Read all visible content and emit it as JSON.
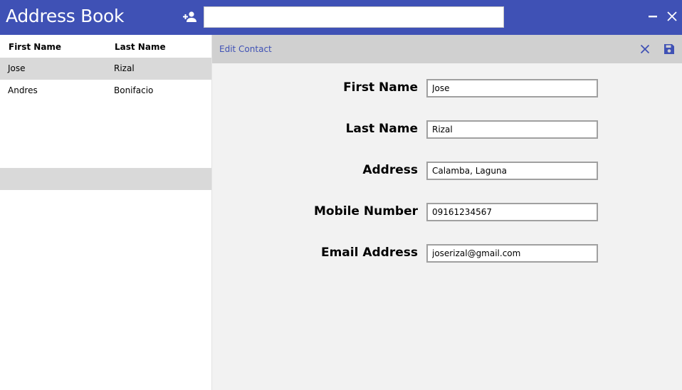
{
  "app": {
    "title": "Address Book"
  },
  "search": {
    "value": "",
    "placeholder": ""
  },
  "list": {
    "columns": [
      "First Name",
      "Last Name"
    ],
    "rows": [
      {
        "first": "Jose",
        "last": "Rizal",
        "selected": true
      },
      {
        "first": "Andres",
        "last": "Bonifacio",
        "selected": false
      }
    ]
  },
  "editor": {
    "title": "Edit Contact",
    "fields": [
      {
        "label": "First Name",
        "value": "Jose"
      },
      {
        "label": "Last Name",
        "value": "Rizal"
      },
      {
        "label": "Address",
        "value": "Calamba, Laguna"
      },
      {
        "label": "Mobile Number",
        "value": "09161234567"
      },
      {
        "label": "Email Address",
        "value": "joserizal@gmail.com"
      }
    ]
  },
  "icons": {
    "add_user": "add-user-icon",
    "minimize": "minimize-icon",
    "close": "close-icon",
    "cancel": "cancel-icon",
    "save": "save-icon"
  },
  "colors": {
    "accent": "#3f51b5",
    "selected_row": "#d9d9d9",
    "editor_background": "#f2f2f2",
    "editor_header": "#d0d0d0"
  }
}
